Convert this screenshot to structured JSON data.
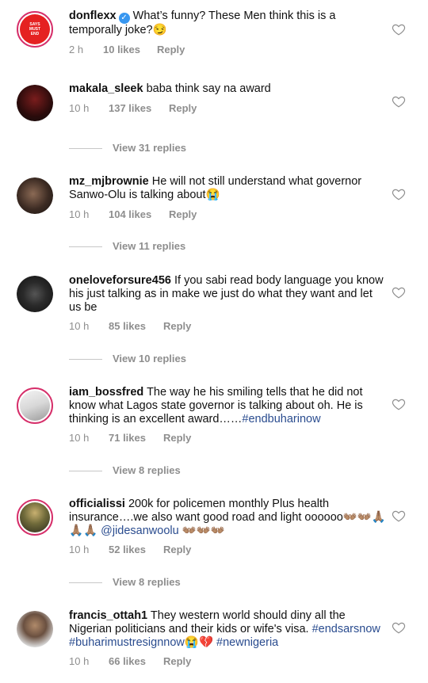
{
  "comments": [
    {
      "username": "donflexx",
      "verified": true,
      "text": "What’s funny? These Men think this is a temporally joke?😏",
      "time": "2 h",
      "likes": "10 likes",
      "reply": "Reply",
      "view_replies": ""
    },
    {
      "username": "makala_sleek",
      "text": "baba think say na award",
      "time": "10 h",
      "likes": "137 likes",
      "reply": "Reply",
      "view_replies": "View 31 replies"
    },
    {
      "username": "mz_mjbrownie",
      "text": "He will not still understand  what governor Sanwo-Olu is talking about😭",
      "time": "10 h",
      "likes": "104 likes",
      "reply": "Reply",
      "view_replies": "View 11 replies"
    },
    {
      "username": "oneloveforsure456",
      "text": "If you sabi read body language you know his just talking as in make we just do what they want and let us be",
      "time": "10 h",
      "likes": "85 likes",
      "reply": "Reply",
      "view_replies": "View 10 replies"
    },
    {
      "username": "iam_bossfred",
      "text": "The way he his smiling tells that he did not know what Lagos state governor is talking about oh.  He is thinking is an excellent award……",
      "hashtag": "#endbuharinow",
      "time": "10 h",
      "likes": "71 likes",
      "reply": "Reply",
      "view_replies": "View 8 replies"
    },
    {
      "username": "officialissi",
      "text": "200k for policemen monthly  Plus health insurance….we also want good road and light oooooo👐🏽👐🏽🙏🏽🙏🏽🙏🏽 ",
      "mention": "@jidesanwoolu",
      "text_tail": " 👐🏽👐🏽👐🏽",
      "time": "10 h",
      "likes": "52 likes",
      "reply": "Reply",
      "view_replies": "View 8 replies"
    },
    {
      "username": "francis_ottah1",
      "text": "They western world should diny all the Nigerian politicians and their kids or wife's visa. ",
      "hashtags": "#endsarsnow #buharimustresignnow",
      "emoji": "😭💔",
      "hashtag_tail": "#newnigeria",
      "time": "10 h",
      "likes": "66 likes",
      "reply": "Reply",
      "view_replies": ""
    }
  ],
  "avatar_tiny_text": "SAYS MUST END"
}
